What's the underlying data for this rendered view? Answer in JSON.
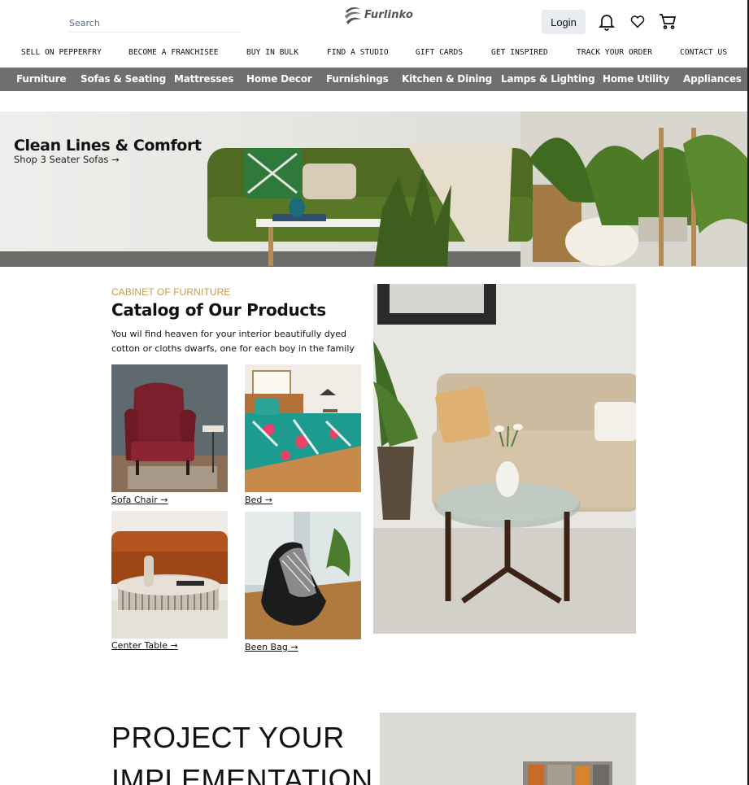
{
  "header": {
    "search_placeholder": "Search",
    "brand": "Furlinko",
    "login_label": "Login",
    "icons": [
      "bell-icon",
      "heart-icon",
      "cart-icon"
    ]
  },
  "top_links": [
    "SELL ON PEPPERFRY",
    "BECOME A FRANCHISEE",
    "BUY IN BULK",
    "FIND A STUDIO",
    "GIFT CARDS",
    "GET INSPIRED",
    "TRACK YOUR ORDER",
    "CONTACT US"
  ],
  "categories": [
    "Furniture",
    "Sofas & Seating",
    "Mattresses",
    "Home Decor",
    "Furnishings",
    "Kitchen & Dining",
    "Lamps & Lighting",
    "Home Utility",
    "Appliances"
  ],
  "hero": {
    "title": "Clean Lines & Comfort",
    "link": "Shop 3 Seater Sofas →"
  },
  "catalog": {
    "eyebrow": "CABINET OF FURNITURE",
    "title": "Catalog of Our Products",
    "description": "You wil find heaven for your interior beautifully dyed cotton or cloths dwarfs, one for each boy in the family",
    "items": [
      {
        "label": "Sofa Chair →"
      },
      {
        "label": "Bed →"
      },
      {
        "label": "Center Table →"
      },
      {
        "label": "Been Bag →"
      }
    ]
  },
  "project": {
    "heading": "PROJECT YOUR IMPLEMENTATION"
  },
  "colors": {
    "nav_bg": "#6f6f6f",
    "eyebrow": "#c89a4a",
    "login_bg": "#e9edf2"
  }
}
